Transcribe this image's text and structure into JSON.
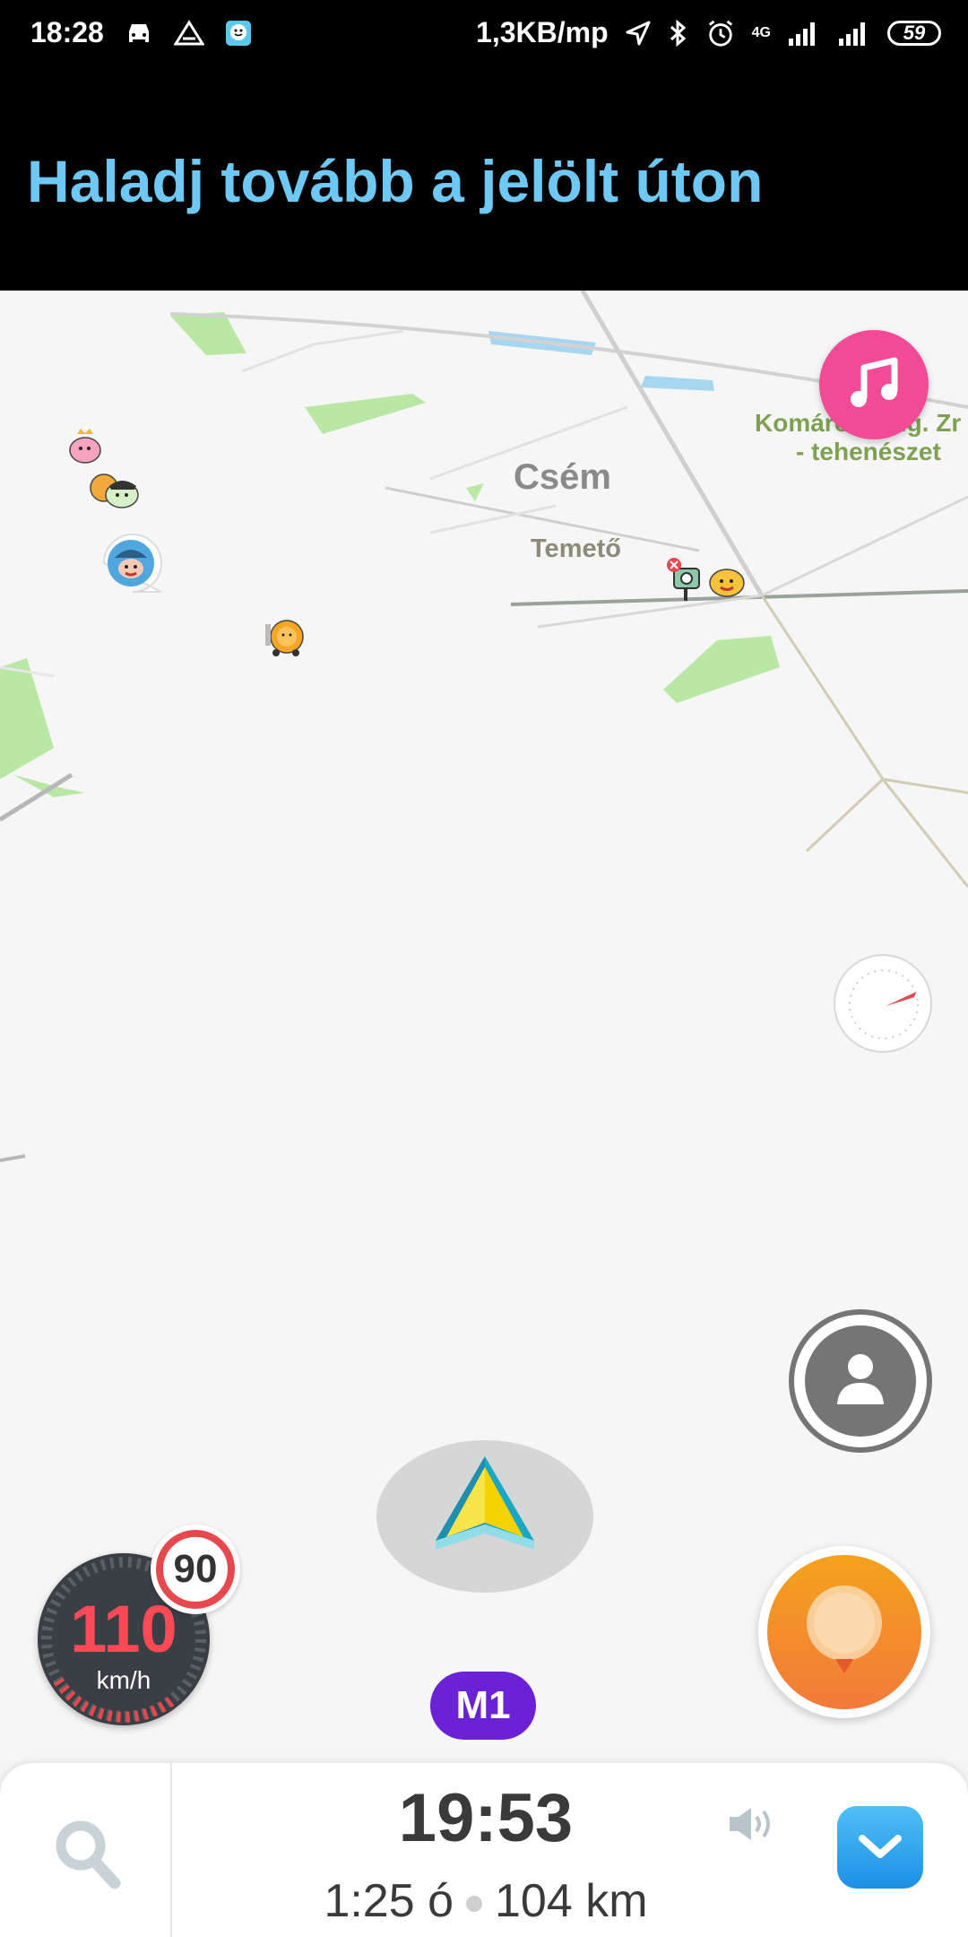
{
  "status_bar": {
    "time": "18:28",
    "network_speed": "1,3KB/mp",
    "battery": "59",
    "network_type": "4G",
    "icons_left": [
      "car-icon",
      "triangle-a-icon",
      "waze-icon"
    ],
    "icons_right": [
      "location-arrow-icon",
      "bluetooth-icon",
      "alarm-icon",
      "signal-icon",
      "signal-icon",
      "battery-icon"
    ]
  },
  "banner": {
    "instruction": "Haladj tovább a jelölt úton"
  },
  "map": {
    "labels": {
      "town": "Csém",
      "cemetery": "Temető",
      "poi_line1": "Komáromi Mg. Zr",
      "poi_line2": "- tehenészet"
    },
    "road_shield": "M1"
  },
  "speedometer": {
    "speed": "110",
    "unit": "km/h",
    "speed_limit": "90",
    "colors": {
      "ring": "#e5484d",
      "dial": "#3a3f46",
      "limit_border": "#e5484d"
    }
  },
  "bottom": {
    "eta": "19:53",
    "remaining_time": "1:25 ó",
    "distance": "104 km"
  },
  "colors": {
    "banner_text": "#6ec8f4",
    "music_button": "#f24b96",
    "report_button": "#f28c28",
    "collapse_button": "#2b9cf0",
    "road_shield": "#6b21d6"
  }
}
